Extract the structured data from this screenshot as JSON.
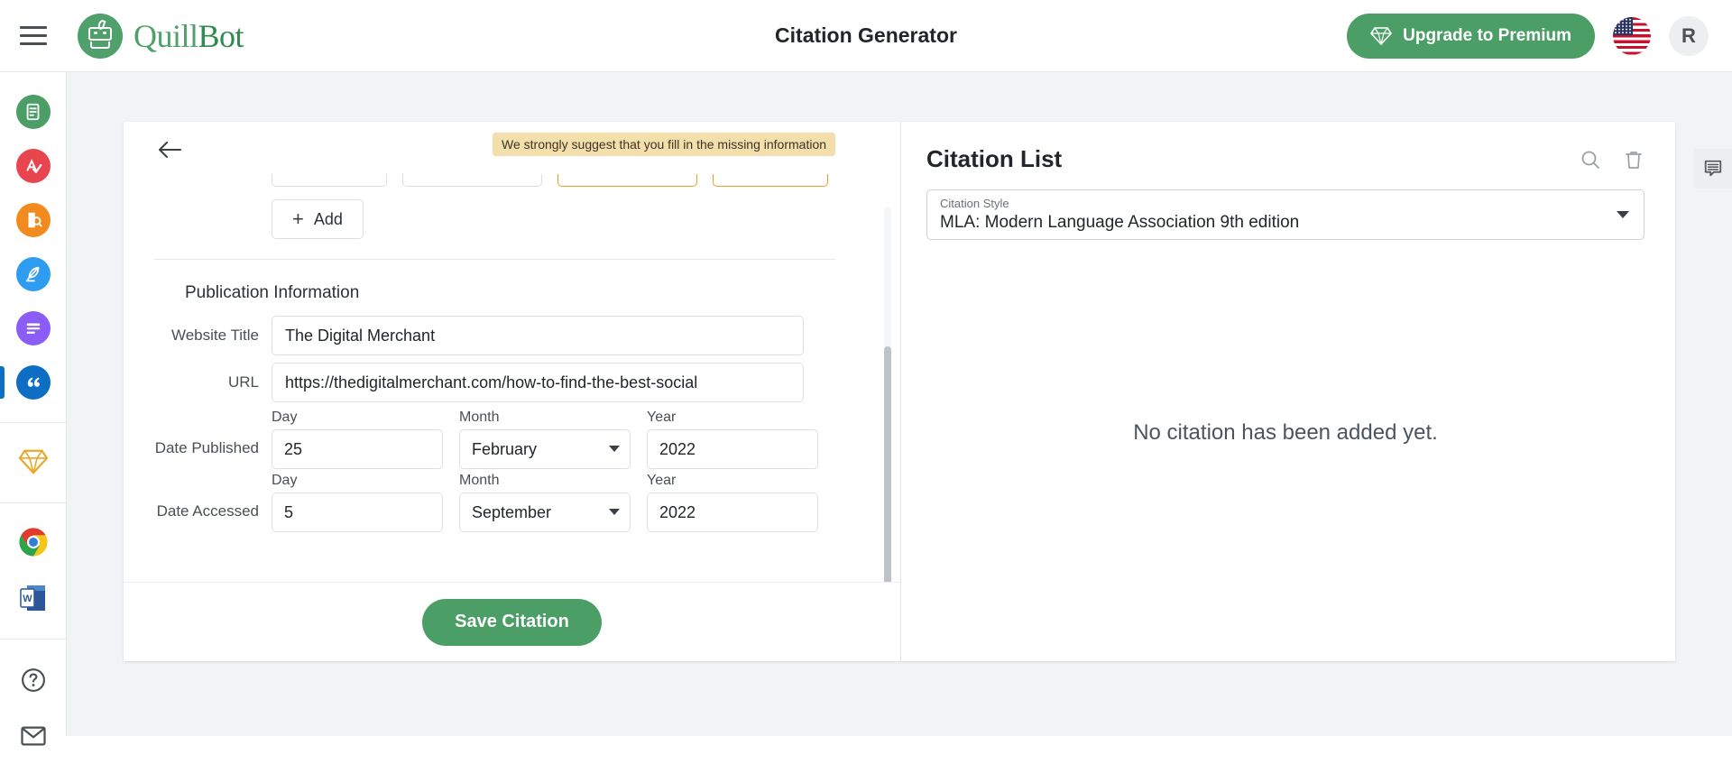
{
  "header": {
    "title": "Citation Generator",
    "menu_icon": "hamburger-menu-icon",
    "brand_part1": "Quill",
    "brand_part2": "Bot",
    "upgrade_label": "Upgrade to Premium",
    "upgrade_icon": "diamond-icon",
    "flag_icon": "us-flag-icon",
    "avatar_initial": "R",
    "accent_green": "#4a9e66"
  },
  "sidebar": {
    "items": [
      {
        "name": "paraphraser",
        "color": "#4a9e66",
        "icon": "document-refresh-icon",
        "active": false
      },
      {
        "name": "grammar-checker",
        "color": "#e8454f",
        "icon": "letter-a-check-icon",
        "active": false
      },
      {
        "name": "plagiarism-checker",
        "color": "#f28b1e",
        "icon": "document-search-icon",
        "active": false
      },
      {
        "name": "co-writer",
        "color": "#2e9cf0",
        "icon": "feather-pen-icon",
        "active": false
      },
      {
        "name": "summarizer",
        "color": "#8b5cf6",
        "icon": "summary-lines-icon",
        "active": false
      },
      {
        "name": "citation-generator",
        "color": "#0d6ec4",
        "icon": "quotation-marks-icon",
        "active": true
      }
    ],
    "premium_icon": "gold-diamond-icon",
    "extensions": [
      {
        "name": "chrome-extension",
        "icon": "chrome-icon"
      },
      {
        "name": "word-addin",
        "icon": "ms-word-icon"
      }
    ],
    "footer": [
      {
        "name": "help",
        "icon": "question-mark-circle-icon"
      },
      {
        "name": "contact",
        "icon": "envelope-icon"
      }
    ]
  },
  "form": {
    "back_icon": "back-arrow-icon",
    "warning": "We strongly suggest that you fill in the missing information",
    "add_label": "Add",
    "add_icon": "plus-icon",
    "section_title": "Publication Information",
    "website_title_label": "Website Title",
    "website_title_value": "The Digital Merchant",
    "url_label": "URL",
    "url_value": "https://thedigitalmerchant.com/how-to-find-the-best-social",
    "date_published_label": "Date Published",
    "date_accessed_label": "Date Accessed",
    "day_label": "Day",
    "month_label": "Month",
    "year_label": "Year",
    "published_day": "25",
    "published_month": "February",
    "published_year": "2022",
    "accessed_day": "5",
    "accessed_month": "September",
    "accessed_year": "2022",
    "save_label": "Save Citation"
  },
  "citation_list": {
    "title": "Citation List",
    "search_icon": "search-icon",
    "delete_icon": "trash-icon",
    "style_label": "Citation Style",
    "style_value": "MLA: Modern Language Association 9th edition",
    "empty_message": "No citation has been added yet."
  },
  "feedback": {
    "icon": "feedback-comment-icon"
  }
}
